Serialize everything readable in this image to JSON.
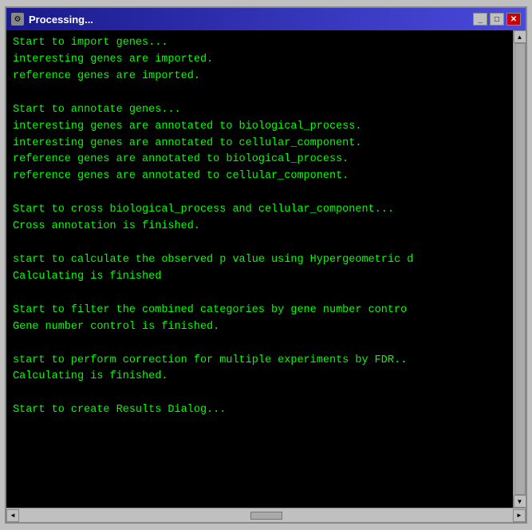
{
  "window": {
    "title": "Processing...",
    "title_icon": "⚙",
    "btn_minimize": "_",
    "btn_maximize": "□",
    "btn_close": "✕"
  },
  "console": {
    "lines": [
      "Start to import genes...",
      "interesting genes are imported.",
      "reference genes are imported.",
      "",
      "Start to annotate genes...",
      "interesting genes are annotated to biological_process.",
      "interesting genes are annotated to cellular_component.",
      "reference genes are annotated to biological_process.",
      "reference genes are annotated to cellular_component.",
      "",
      "Start to cross biological_process and cellular_component...",
      "Cross annotation is finished.",
      "",
      "start to calculate the observed p value using Hypergeometric d",
      "Calculating is finished",
      "",
      "Start to filter the combined categories by gene number contro",
      "Gene number control is finished.",
      "",
      "start to perform correction for multiple experiments by FDR..",
      "Calculating is finished.",
      "",
      "Start to create Results Dialog..."
    ]
  },
  "colors": {
    "text": "#00ff00",
    "background": "#000000",
    "titlebar": "#1a1a8c"
  }
}
